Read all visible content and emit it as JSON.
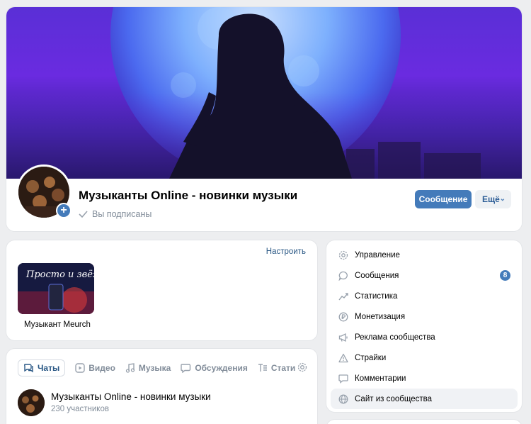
{
  "header": {
    "title": "Музыканты Online - новинки музыки",
    "subscribed_label": "Вы подписаны",
    "message_button": "Сообщение",
    "more_button": "Ещё"
  },
  "apps": {
    "setup_link": "Настроить",
    "items": [
      {
        "label": "Музыкант Meurch",
        "thumb_text": "Просто и звёзды"
      }
    ]
  },
  "tabs": [
    {
      "label": "Чаты",
      "icon": "chat-icon",
      "active": true
    },
    {
      "label": "Видео",
      "icon": "video-icon",
      "active": false
    },
    {
      "label": "Музыка",
      "icon": "music-icon",
      "active": false
    },
    {
      "label": "Обсуждения",
      "icon": "discussion-icon",
      "active": false
    },
    {
      "label": "Стати",
      "icon": "articles-icon",
      "active": false
    }
  ],
  "chat": {
    "title": "Музыканты Online - новинки музыки",
    "members": "230 участников"
  },
  "menu": {
    "items": [
      {
        "label": "Управление",
        "icon": "gear-icon",
        "badge": null
      },
      {
        "label": "Сообщения",
        "icon": "message-icon",
        "badge": "8"
      },
      {
        "label": "Статистика",
        "icon": "stats-icon",
        "badge": null
      },
      {
        "label": "Монетизация",
        "icon": "ruble-icon",
        "badge": null
      },
      {
        "label": "Реклама сообщества",
        "icon": "megaphone-icon",
        "badge": null
      },
      {
        "label": "Страйки",
        "icon": "warning-icon",
        "badge": null
      },
      {
        "label": "Комментарии",
        "icon": "comment-icon",
        "badge": null
      },
      {
        "label": "Сайт из сообщества",
        "icon": "globe-icon",
        "badge": null,
        "active": true
      }
    ]
  },
  "colors": {
    "accent": "#447bba",
    "link": "#2a5885",
    "background": "#edeef0",
    "muted_text": "#818c99"
  }
}
